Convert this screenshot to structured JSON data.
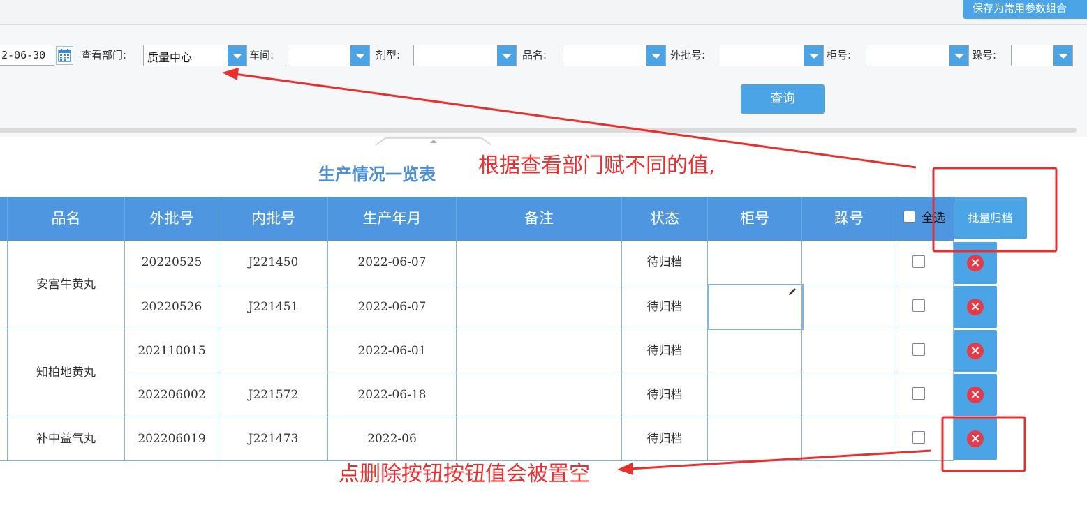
{
  "toolbar": {
    "save_combo_label": "保存为常用参数组合"
  },
  "filters": {
    "date_value": "2-06-30",
    "dept_label": "查看部门:",
    "dept_value": "质量中心",
    "workshop_label": "车间:",
    "dosage_label": "剂型:",
    "product_label": "品名:",
    "ext_batch_label": "外批号:",
    "cabinet_label": "柜号:",
    "stack_label": "跺号:",
    "query_label": "查询"
  },
  "table": {
    "title": "生产情况一览表",
    "headers": {
      "product": "品名",
      "ext_batch": "外批号",
      "int_batch": "内批号",
      "prod_date": "生产年月",
      "remark": "备注",
      "status": "状态",
      "cabinet": "柜号",
      "stack": "跺号",
      "select_all": "全选"
    },
    "batch_archive_label": "批量归档",
    "groups": [
      {
        "product": "安宫牛黄丸"
      },
      {
        "product": "知柏地黄丸"
      },
      {
        "product": "补中益气丸"
      }
    ],
    "rows": [
      {
        "ext_batch": "20220525",
        "int_batch": "J221450",
        "prod_date": "2022-06-07",
        "remark": "",
        "status": "待归档",
        "cabinet": "",
        "stack": ""
      },
      {
        "ext_batch": "20220526",
        "int_batch": "J221451",
        "prod_date": "2022-06-07",
        "remark": "",
        "status": "待归档",
        "cabinet": "",
        "stack": ""
      },
      {
        "ext_batch": "202110015",
        "int_batch": "",
        "prod_date": "2022-06-01",
        "remark": "",
        "status": "待归档",
        "cabinet": "",
        "stack": ""
      },
      {
        "ext_batch": "202206002",
        "int_batch": "J221572",
        "prod_date": "2022-06-18",
        "remark": "",
        "status": "待归档",
        "cabinet": "",
        "stack": ""
      },
      {
        "ext_batch": "202206019",
        "int_batch": "J221473",
        "prod_date": "2022-06",
        "remark": "",
        "status": "待归档",
        "cabinet": "",
        "stack": ""
      }
    ]
  },
  "annotations": {
    "top_note": "根据查看部门赋不同的值,",
    "bottom_note": "点删除按钮按钮值会被置空",
    "color": "#e8302f"
  },
  "colors": {
    "accent": "#4aa4e6",
    "header": "#4e97e0",
    "title": "#4a8fd9",
    "delete": "#e23c4a"
  }
}
